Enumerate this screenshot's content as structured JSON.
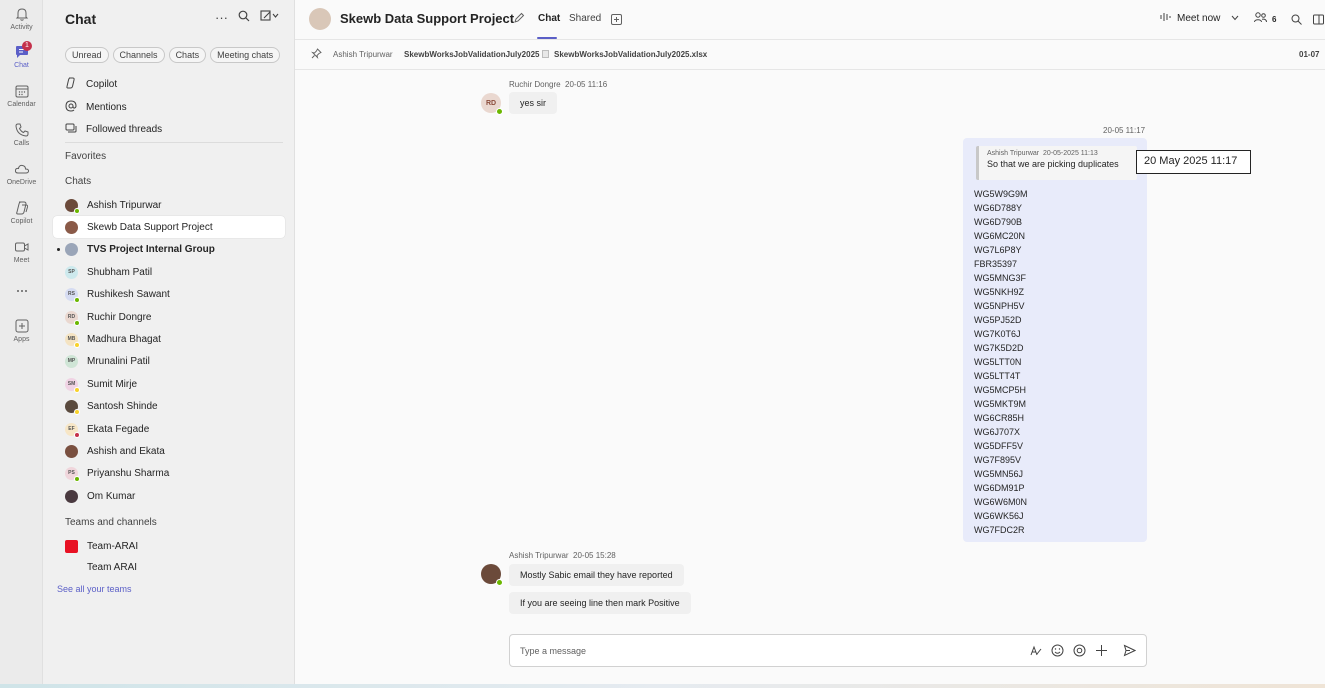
{
  "rail": {
    "items": [
      {
        "label": "Activity",
        "icon": "bell-icon"
      },
      {
        "label": "Chat",
        "icon": "chat-icon",
        "badge": "1",
        "active": true
      },
      {
        "label": "Calendar",
        "icon": "calendar-icon"
      },
      {
        "label": "Calls",
        "icon": "phone-icon"
      },
      {
        "label": "OneDrive",
        "icon": "cloud-icon"
      },
      {
        "label": "Copilot",
        "icon": "copilot-icon"
      },
      {
        "label": "Meet",
        "icon": "video-icon"
      },
      {
        "label": "",
        "icon": "more-icon"
      },
      {
        "label": "Apps",
        "icon": "plus-box-icon"
      }
    ]
  },
  "panel": {
    "title": "Chat",
    "filters": [
      "Unread",
      "Channels",
      "Chats",
      "Meeting chats"
    ],
    "nav": [
      {
        "label": "Copilot",
        "icon": "copilot-icon"
      },
      {
        "label": "Mentions",
        "icon": "at-icon"
      },
      {
        "label": "Followed threads",
        "icon": "threads-icon"
      }
    ],
    "favorites_label": "Favorites",
    "chats_label": "Chats",
    "chats": [
      {
        "name": "Ashish Tripurwar",
        "initials": "",
        "avatar_color": "#6b4a3a",
        "presence": "#6bb700"
      },
      {
        "name": "Skewb Data Support Project",
        "initials": "",
        "avatar_color": "#8a5a48",
        "presence": "",
        "selected": true
      },
      {
        "name": "TVS Project Internal Group",
        "initials": "",
        "avatar_color": "#9aa5b8",
        "presence": "",
        "bold": true,
        "unread": true
      },
      {
        "name": "Shubham Patil",
        "initials": "SP",
        "avatar_color": "#cde9ed",
        "presence": ""
      },
      {
        "name": "Rushikesh Sawant",
        "initials": "RS",
        "avatar_color": "#d6dcf2",
        "presence": "#6bb700"
      },
      {
        "name": "Ruchir Dongre",
        "initials": "RD",
        "avatar_color": "#ead8d0",
        "presence": "#6bb700"
      },
      {
        "name": "Madhura Bhagat",
        "initials": "MB",
        "avatar_color": "#f4e3c2",
        "presence": "#f8d22a"
      },
      {
        "name": "Mrunalini Patil",
        "initials": "MP",
        "avatar_color": "#cfe5d6",
        "presence": ""
      },
      {
        "name": "Sumit Mirje",
        "initials": "SM",
        "avatar_color": "#f0d3e4",
        "presence": "#f8d22a"
      },
      {
        "name": "Santosh Shinde",
        "initials": "",
        "avatar_color": "#5a4a3e",
        "presence": "#f8d22a"
      },
      {
        "name": "Ekata Fegade",
        "initials": "EF",
        "avatar_color": "#f7e6c6",
        "presence": "#c4314b"
      },
      {
        "name": "Ashish and Ekata",
        "initials": "",
        "avatar_color": "#7a5040",
        "presence": ""
      },
      {
        "name": "Priyanshu Sharma",
        "initials": "PS",
        "avatar_color": "#f0d6dc",
        "presence": "#6bb700"
      },
      {
        "name": "Om Kumar",
        "initials": "",
        "avatar_color": "#4a3a40",
        "presence": ""
      }
    ],
    "teams_label": "Teams and channels",
    "teams": [
      {
        "name": "Team-ARAI",
        "icon_color": "#e81123"
      },
      {
        "name": "Team ARAI",
        "icon_color": ""
      }
    ],
    "see_all": "See all your teams"
  },
  "header": {
    "title": "Skewb Data Support Project",
    "tabs": [
      "Chat",
      "Shared"
    ],
    "meet_now": "Meet now",
    "participants": "6"
  },
  "pinned": {
    "author": "Ashish Tripurwar",
    "subject": "SkewbWorksJobValidationJuly2025",
    "file": "SkewbWorksJobValidationJuly2025.xlsx",
    "date": "01-07"
  },
  "messages": {
    "m1": {
      "author": "Ruchir Dongre",
      "time": "20-05 11:16",
      "text": "yes sir",
      "initials": "RD"
    },
    "mine": {
      "time": "20-05 11:17",
      "quote_author": "Ashish Tripurwar",
      "quote_time": "20-05-2025 11:13",
      "quote_text": "So that we are picking duplicates",
      "codes": [
        "WG5W9G9M",
        "WG6D788Y",
        "WG6D790B",
        "WG6MC20N",
        "WG7L6P8Y",
        "FBR35397",
        "WG5MNG3F",
        "WG5NKH9Z",
        "WG5NPH5V",
        "WG5PJ52D",
        "WG7K0T6J",
        "WG7K5D2D",
        "WG5LTT0N",
        "WG5LTT4T",
        "WG5MCP5H",
        "WG5MKT9M",
        "WG6CR85H",
        "WG6J707X",
        "WG5DFF5V",
        "WG7F895V",
        "WG5MN56J",
        "WG6DM91P",
        "WG6W6M0N",
        "WG6WK56J",
        "WG7FDC2R"
      ]
    },
    "tooltip": "20 May 2025 11:17",
    "m2": {
      "author": "Ashish Tripurwar",
      "time": "20-05 15:28",
      "lines": [
        "Mostly Sabic email they have reported",
        "If you are seeing line then mark Positive"
      ]
    }
  },
  "composer": {
    "placeholder": "Type a message"
  }
}
